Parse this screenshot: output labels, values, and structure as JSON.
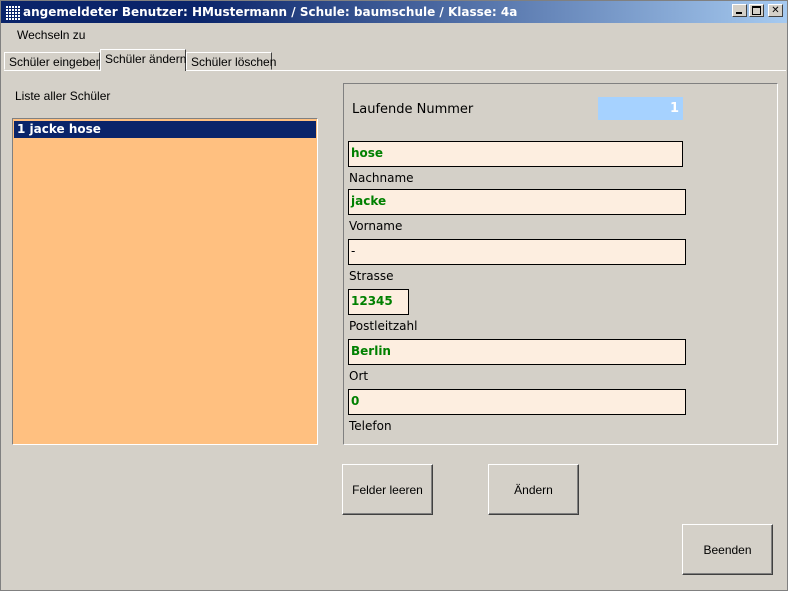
{
  "window": {
    "title": "angemeldeter Benutzer: HMustermann / Schule: baumschule / Klasse: 4a"
  },
  "menu": {
    "items": [
      "Wechseln zu"
    ]
  },
  "tabs": [
    {
      "label": "Schüler eingeben",
      "active": false
    },
    {
      "label": "Schüler ändern",
      "active": true
    },
    {
      "label": "Schüler löschen",
      "active": false
    }
  ],
  "list": {
    "label": "Liste aller Schüler",
    "items": [
      "1 jacke hose"
    ],
    "selected": 0,
    "background": "#ffc080"
  },
  "form": {
    "laufende_nummer": {
      "label": "Laufende Nummer",
      "value": "1"
    },
    "nachname": {
      "label": "Nachname",
      "value": "hose"
    },
    "vorname": {
      "label": "Vorname",
      "value": "jacke"
    },
    "strasse": {
      "label": "Strasse",
      "value": "-"
    },
    "postleitzahl": {
      "label": "Postleitzahl",
      "value": "12345"
    },
    "ort": {
      "label": "Ort",
      "value": "Berlin"
    },
    "telefon": {
      "label": "Telefon",
      "value": "0"
    }
  },
  "buttons": {
    "clear": "Felder leeren",
    "change": "Ändern",
    "exit": "Beenden"
  },
  "colors": {
    "titlebar": "#0a246a",
    "field_bg": "#fdeee0",
    "field_text": "#008000",
    "number_bg": "#a6d2ff"
  }
}
